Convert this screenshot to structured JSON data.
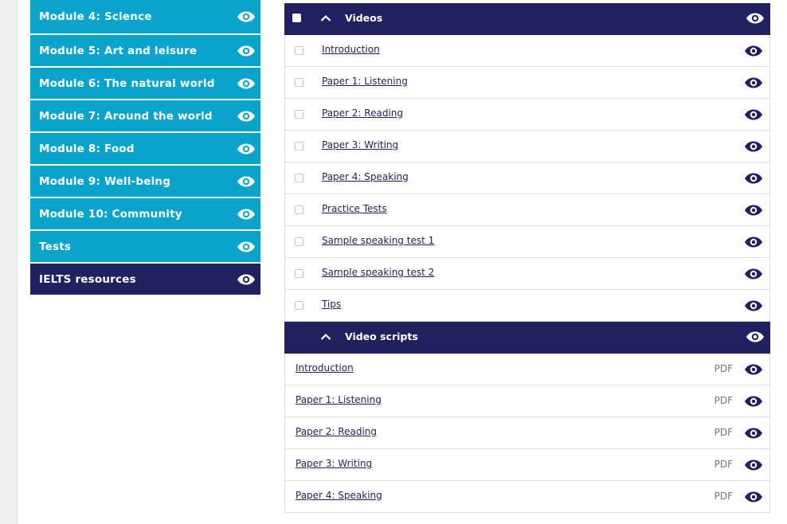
{
  "sidebar": {
    "items": [
      {
        "label": "Module 4: Science"
      },
      {
        "label": "Module 5: Art and leisure"
      },
      {
        "label": "Module 6: The natural world"
      },
      {
        "label": "Module 7: Around the world"
      },
      {
        "label": "Module 8: Food"
      },
      {
        "label": "Module 9: Well-being"
      },
      {
        "label": "Module 10: Community"
      },
      {
        "label": "Tests"
      },
      {
        "label": "IELTS resources"
      }
    ]
  },
  "videos": {
    "title": "Videos",
    "items": [
      {
        "label": "Introduction"
      },
      {
        "label": "Paper 1: Listening"
      },
      {
        "label": "Paper 2: Reading"
      },
      {
        "label": "Paper 3: Writing"
      },
      {
        "label": "Paper 4: Speaking"
      },
      {
        "label": "Practice Tests"
      },
      {
        "label": "Sample speaking test 1"
      },
      {
        "label": "Sample speaking test 2"
      },
      {
        "label": "Tips"
      }
    ]
  },
  "video_scripts": {
    "title": "Video scripts",
    "items": [
      {
        "label": "Introduction",
        "type": "PDF"
      },
      {
        "label": "Paper 1: Listening",
        "type": "PDF"
      },
      {
        "label": "Paper 2: Reading",
        "type": "PDF"
      },
      {
        "label": "Paper 3: Writing",
        "type": "PDF"
      },
      {
        "label": "Paper 4: Speaking",
        "type": "PDF"
      }
    ]
  },
  "colors": {
    "sidebar_item": "#0aa3cc",
    "sidebar_active": "#222160",
    "header": "#222160",
    "link": "#23225a"
  },
  "icons": {
    "visibility": "eye-icon",
    "collapse": "chevron-up-icon"
  }
}
